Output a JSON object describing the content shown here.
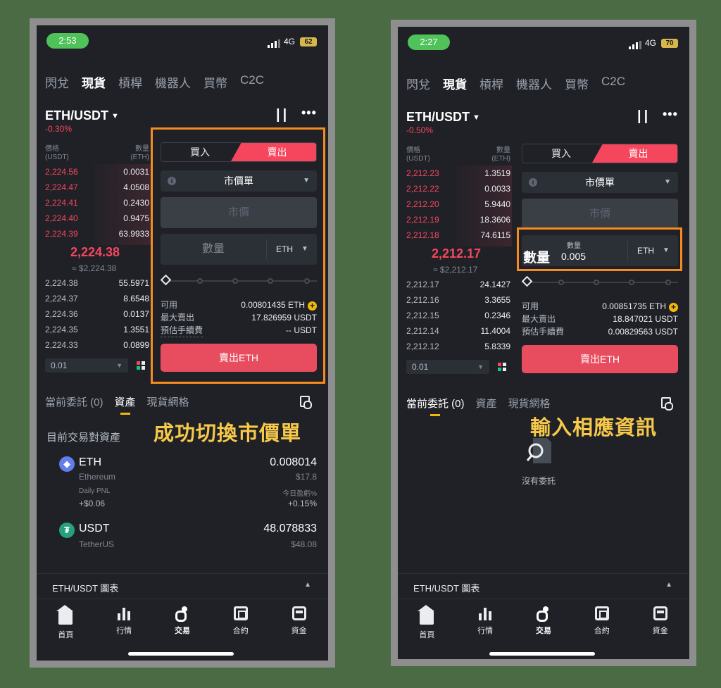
{
  "screens": [
    {
      "status": {
        "time": "2:53",
        "network": "4G",
        "battery": "62"
      },
      "top_tabs": [
        "閃兌",
        "現貨",
        "槓桿",
        "機器人",
        "買幣",
        "C2C"
      ],
      "pair": "ETH/USDT",
      "change": "-0.30%",
      "orderbook": {
        "price_header": "價格",
        "price_unit": "(USDT)",
        "qty_header": "數量",
        "qty_unit": "(ETH)",
        "asks": [
          {
            "price": "2,224.56",
            "qty": "0.0031"
          },
          {
            "price": "2,224.47",
            "qty": "4.0508"
          },
          {
            "price": "2,224.41",
            "qty": "0.2430"
          },
          {
            "price": "2,224.40",
            "qty": "0.9475"
          },
          {
            "price": "2,224.39",
            "qty": "63.9933"
          }
        ],
        "last_price": "2,224.38",
        "last_usd": "≈ $2,224.38",
        "bids": [
          {
            "price": "2,224.38",
            "qty": "55.5971"
          },
          {
            "price": "2,224.37",
            "qty": "8.6548"
          },
          {
            "price": "2,224.36",
            "qty": "0.0137"
          },
          {
            "price": "2,224.35",
            "qty": "1.3551"
          },
          {
            "price": "2,224.33",
            "qty": "0.0899"
          }
        ],
        "tick": "0.01"
      },
      "order": {
        "buy_label": "買入",
        "sell_label": "賣出",
        "type": "市價單",
        "price_placeholder": "市價",
        "qty_label": "數量",
        "qty_unit": "ETH",
        "available_label": "可用",
        "available_value": "0.00801435 ETH",
        "max_sell_label": "最大賣出",
        "max_sell_value": "17.826959 USDT",
        "fee_label": "預估手續費",
        "fee_value": "-- USDT",
        "submit": "賣出ETH"
      },
      "lower_tabs": [
        "當前委託 (0)",
        "資產",
        "現貨網格"
      ],
      "annotation": "成功切換市價單",
      "assets": {
        "title": "目前交易對資產",
        "items": [
          {
            "symbol": "ETH",
            "name": "Ethereum",
            "balance": "0.008014",
            "usd": "$17.8",
            "icon_color": "#627eea",
            "icon": "eth-icon"
          },
          {
            "symbol": "USDT",
            "name": "TetherUS",
            "balance": "48.078833",
            "usd": "$48.08",
            "icon_color": "#26a17b",
            "icon": "tether-icon"
          }
        ],
        "pnl_label": "Daily PNL",
        "pnl_value": "+$0.06",
        "pnl_pct_label": "今日盈虧%",
        "pnl_pct_value": "+0.15%"
      },
      "chart_label": "ETH/USDT 圖表",
      "nav": [
        "首頁",
        "行情",
        "交易",
        "合約",
        "資金"
      ]
    },
    {
      "status": {
        "time": "2:27",
        "network": "4G",
        "battery": "70"
      },
      "top_tabs": [
        "閃兌",
        "現貨",
        "槓桿",
        "機器人",
        "買幣",
        "C2C"
      ],
      "pair": "ETH/USDT",
      "change": "-0.50%",
      "orderbook": {
        "price_header": "價格",
        "price_unit": "(USDT)",
        "qty_header": "數量",
        "qty_unit": "(ETH)",
        "asks": [
          {
            "price": "2,212.23",
            "qty": "1.3519"
          },
          {
            "price": "2,212.22",
            "qty": "0.0033"
          },
          {
            "price": "2,212.20",
            "qty": "5.9440"
          },
          {
            "price": "2,212.19",
            "qty": "18.3606"
          },
          {
            "price": "2,212.18",
            "qty": "74.6115"
          }
        ],
        "last_price": "2,212.17",
        "last_usd": "≈ $2,212.17",
        "bids": [
          {
            "price": "2,212.17",
            "qty": "24.1427"
          },
          {
            "price": "2,212.16",
            "qty": "3.3655"
          },
          {
            "price": "2,212.15",
            "qty": "0.2346"
          },
          {
            "price": "2,212.14",
            "qty": "11.4004"
          },
          {
            "price": "2,212.12",
            "qty": "5.8339"
          }
        ],
        "tick": "0.01"
      },
      "order": {
        "buy_label": "買入",
        "sell_label": "賣出",
        "type": "市價單",
        "price_placeholder": "市價",
        "qty_overlay": "數量",
        "qty_small_label": "數量",
        "qty_value": "0.005",
        "qty_unit": "ETH",
        "available_label": "可用",
        "available_value": "0.00851735 ETH",
        "max_sell_label": "最大賣出",
        "max_sell_value": "18.847021 USDT",
        "fee_label": "預估手續費",
        "fee_value": "0.00829563 USDT",
        "submit": "賣出ETH"
      },
      "lower_tabs": [
        "當前委託 (0)",
        "資產",
        "現貨網格"
      ],
      "annotation": "輸入相應資訊",
      "empty_text": "沒有委託",
      "chart_label": "ETH/USDT 圖表",
      "nav": [
        "首頁",
        "行情",
        "交易",
        "合約",
        "資金"
      ]
    }
  ],
  "colors": {
    "sell": "#f6465d",
    "highlight": "#f68b1f",
    "annotation": "#f7c948",
    "accent": "#f0b90b"
  }
}
